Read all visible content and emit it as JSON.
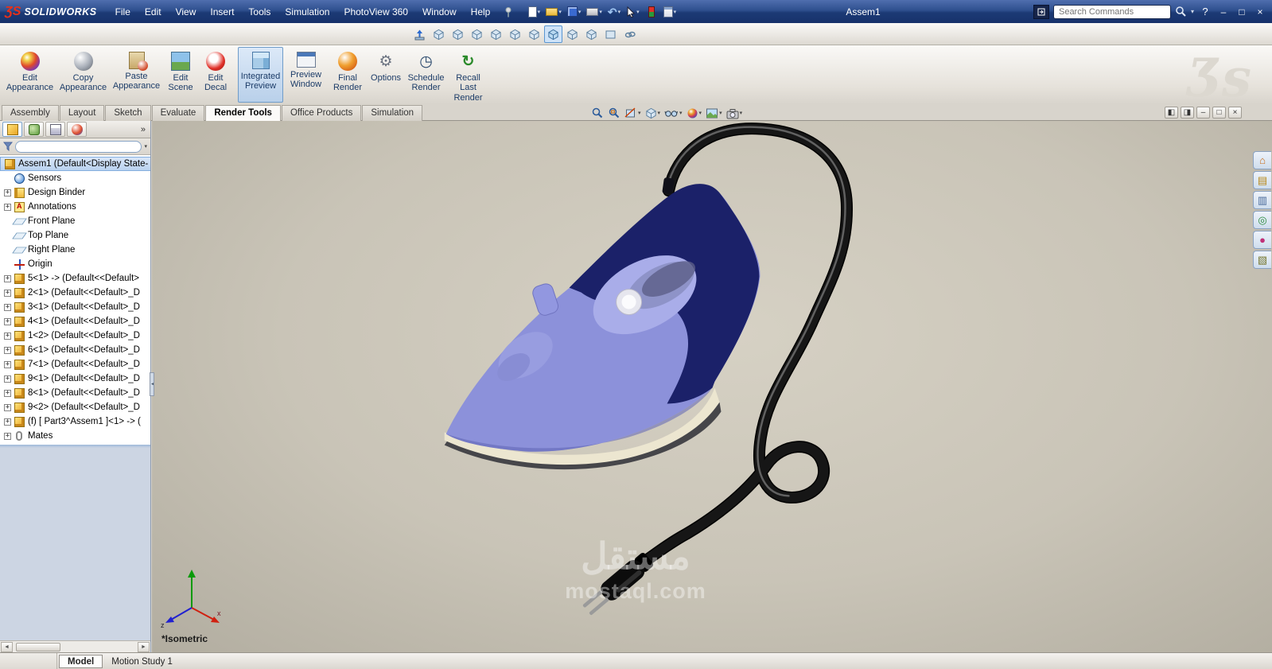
{
  "titlebar": {
    "logo_mark": "ƷS",
    "brand": "SOLIDWORKS",
    "title": "Assem1",
    "search_placeholder": "Search Commands"
  },
  "menubar": {
    "menus": [
      "File",
      "Edit",
      "View",
      "Insert",
      "Tools",
      "Simulation",
      "PhotoView 360",
      "Window",
      "Help"
    ]
  },
  "icons": {
    "caret": "▾",
    "plus": "+",
    "help": "?",
    "minimize": "–",
    "restore": "□",
    "close": "×",
    "chevrons": "»",
    "scroll_left": "◄",
    "scroll_right": "►",
    "pane_left": "◧",
    "pane_right": "◨",
    "gear": "⚙",
    "clock": "◷",
    "refresh": "↻",
    "undo": "↶",
    "splitter": "◄"
  },
  "ribbon": {
    "ds_watermark": "Ʒs",
    "buttons": [
      {
        "label": "Edit Appearance"
      },
      {
        "label": "Copy Appearance"
      },
      {
        "label": "Paste Appearance"
      },
      {
        "label": "Edit Scene"
      },
      {
        "label": "Edit Decal"
      },
      {
        "label": "Integrated Preview",
        "active": true
      },
      {
        "label": "Preview Window"
      },
      {
        "label": "Final Render"
      },
      {
        "label": "Options"
      },
      {
        "label": "Schedule Render"
      },
      {
        "label": "Recall Last Render"
      }
    ]
  },
  "command_tabs": [
    "Assembly",
    "Layout",
    "Sketch",
    "Evaluate",
    "Render Tools",
    "Office Products",
    "Simulation"
  ],
  "tree": {
    "root": "Assem1  (Default<Display State-",
    "items": [
      "Sensors",
      "Design Binder",
      "Annotations",
      "Front Plane",
      "Top Plane",
      "Right Plane",
      "Origin",
      "5<1> -> (Default<<Default>",
      "2<1> (Default<<Default>_D",
      "3<1> (Default<<Default>_D",
      "4<1> (Default<<Default>_D",
      "1<2> (Default<<Default>_D",
      "6<1> (Default<<Default>_D",
      "7<1> (Default<<Default>_D",
      "9<1> (Default<<Default>_D",
      "8<1> (Default<<Default>_D",
      "9<2> (Default<<Default>_D",
      "(f) [ Part3^Assem1 ]<1> -> (",
      "Mates"
    ]
  },
  "viewport": {
    "view_label": "*Isometric",
    "watermark_line1": "مستقل",
    "watermark_line2": "mostaql.com"
  },
  "taskpane": {
    "items": [
      {
        "glyph": "⌂"
      },
      {
        "glyph": "▤"
      },
      {
        "glyph": "▥"
      },
      {
        "glyph": "◎"
      },
      {
        "glyph": "●"
      },
      {
        "glyph": "▧"
      }
    ]
  },
  "statusbar": {
    "tabs": [
      "Model",
      "Motion Study 1"
    ]
  },
  "colors": {
    "titlebar_blue": "#1c3a75",
    "logo_red": "#e8311a",
    "viewport_tan": "#c9c4b7",
    "iron_purple": "#8c91da",
    "iron_navy": "#1b2169",
    "iron_cream": "#ece6d0",
    "selection_blue": "#b9d2ef"
  }
}
